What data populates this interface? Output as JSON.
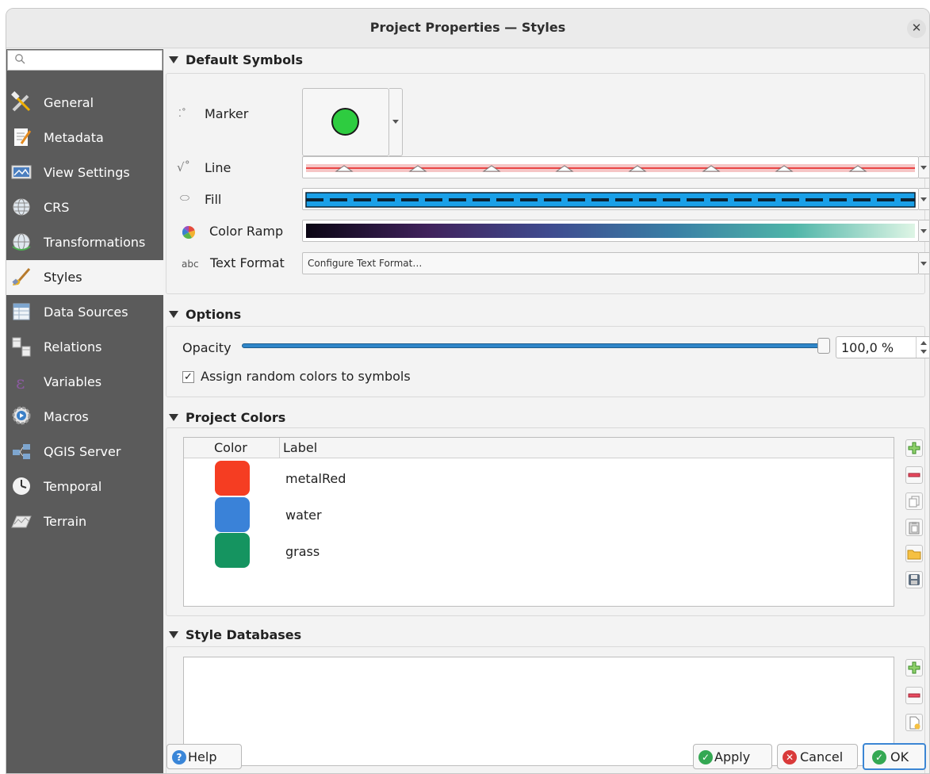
{
  "window": {
    "title": "Project Properties — Styles"
  },
  "search": {
    "placeholder": ""
  },
  "sidebar": {
    "items": [
      {
        "label": "General",
        "icon": "general-tools-icon"
      },
      {
        "label": "Metadata",
        "icon": "metadata-icon"
      },
      {
        "label": "View Settings",
        "icon": "view-settings-icon"
      },
      {
        "label": "CRS",
        "icon": "crs-globe-icon"
      },
      {
        "label": "Transformations",
        "icon": "transformations-icon"
      },
      {
        "label": "Styles",
        "icon": "styles-brush-icon",
        "active": true
      },
      {
        "label": "Data Sources",
        "icon": "data-sources-icon"
      },
      {
        "label": "Relations",
        "icon": "relations-icon"
      },
      {
        "label": "Variables",
        "icon": "variables-icon"
      },
      {
        "label": "Macros",
        "icon": "macros-icon"
      },
      {
        "label": "QGIS Server",
        "icon": "qgis-server-icon"
      },
      {
        "label": "Temporal",
        "icon": "temporal-clock-icon"
      },
      {
        "label": "Terrain",
        "icon": "terrain-icon"
      }
    ]
  },
  "default_symbols": {
    "heading": "Default Symbols",
    "marker_label": "Marker",
    "line_label": "Line",
    "fill_label": "Fill",
    "color_ramp_label": "Color Ramp",
    "text_format_label": "Text Format",
    "text_format_button": "Configure Text Format…",
    "marker_color": "#2ecc40"
  },
  "options": {
    "heading": "Options",
    "opacity_label": "Opacity",
    "opacity_value": "100,0 %",
    "opacity_fraction": 1.0,
    "random_colors_label": "Assign random colors to symbols",
    "random_colors_checked": true
  },
  "project_colors": {
    "heading": "Project Colors",
    "col_color": "Color",
    "col_label": "Label",
    "rows": [
      {
        "label": "metalRed",
        "color": "#f53d22"
      },
      {
        "label": "water",
        "color": "#3a82d8"
      },
      {
        "label": "grass",
        "color": "#159460"
      }
    ]
  },
  "style_databases": {
    "heading": "Style Databases"
  },
  "buttons": {
    "help": "Help",
    "apply": "Apply",
    "cancel": "Cancel",
    "ok": "OK"
  }
}
